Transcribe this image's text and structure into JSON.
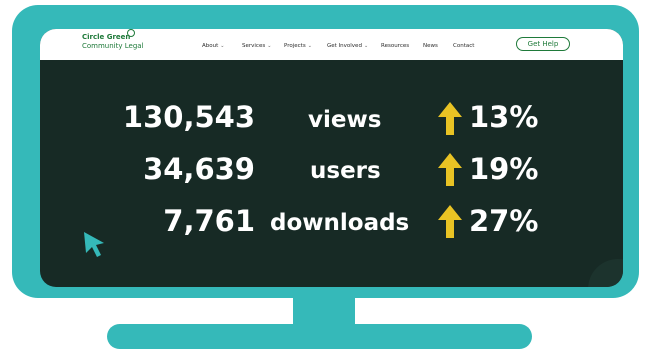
{
  "org": {
    "name_line1": "Circle Green",
    "name_line2": "Community Legal"
  },
  "nav": {
    "about": "About",
    "services": "Services",
    "projects": "Projects",
    "get_involved": "Get Involved",
    "resources": "Resources",
    "news": "News",
    "contact": "Contact",
    "cta": "Get Help"
  },
  "stats": [
    {
      "value": "130,543",
      "label": "views",
      "change": "13%",
      "trend": "up"
    },
    {
      "value": "34,639",
      "label": "users",
      "change": "19%",
      "trend": "up"
    },
    {
      "value": "7,761",
      "label": "downloads",
      "change": "27%",
      "trend": "up"
    }
  ],
  "colors": {
    "frame": "#35b9b9",
    "screen": "#172a25",
    "brand_green": "#1f7a3a",
    "arrow": "#e9c324",
    "text": "#ffffff"
  },
  "icons": {
    "trend_arrow": "arrow-up-icon",
    "pointer": "cursor-icon",
    "logo_mark": "circle-ring-icon"
  }
}
